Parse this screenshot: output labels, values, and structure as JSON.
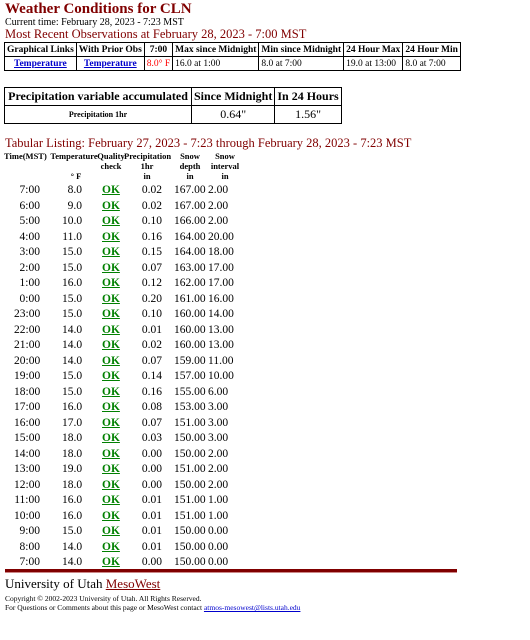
{
  "page": {
    "title": "Weather Conditions for CLN",
    "current_time": "Current time: February 28, 2023 - 7:23 MST",
    "recent_heading": "Most Recent Observations at February 28, 2023 - 7:00 MST"
  },
  "obs_table": {
    "headers": [
      "Graphical Links",
      "With Prior Obs",
      "7:00",
      "Max since Midnight",
      "Min since Midnight",
      "24 Hour Max",
      "24 Hour Min"
    ],
    "link1": "Temperature",
    "link2": "Temperature",
    "current": "8.0° F",
    "max_midnight": "16.0 at 1:00",
    "min_midnight": "8.0 at 7:00",
    "max_24": "19.0 at 13:00",
    "min_24": "8.0 at 7:00"
  },
  "precip_table": {
    "headers": [
      "Precipitation variable accumulated",
      "Since Midnight",
      "In 24 Hours"
    ],
    "label": "Precipitation 1hr",
    "since_midnight": "0.64\"",
    "in_24": "1.56\""
  },
  "tabular": {
    "heading": "Tabular Listing: February 27, 2023 - 7:23 through February 28, 2023 - 7:23 MST",
    "col_time": "Time(MST)",
    "col_temp": "Temperature",
    "col_temp_unit": "° F",
    "col_qc1": "Quality",
    "col_qc2": "check",
    "col_pr1": "Precipitation",
    "col_pr2": "1hr",
    "col_pr3": "in",
    "col_sd1": "Snow",
    "col_sd2": "depth",
    "col_sd3": "in",
    "col_si1": "Snow",
    "col_si2": "interval",
    "col_si3": "in",
    "rows": [
      {
        "time": "7:00",
        "temp": "8.0",
        "qc": "OK",
        "precip": "0.02",
        "depth": "167.00",
        "interval": "2.00"
      },
      {
        "time": "6:00",
        "temp": "9.0",
        "qc": "OK",
        "precip": "0.02",
        "depth": "167.00",
        "interval": "2.00"
      },
      {
        "time": "5:00",
        "temp": "10.0",
        "qc": "OK",
        "precip": "0.10",
        "depth": "166.00",
        "interval": "2.00"
      },
      {
        "time": "4:00",
        "temp": "11.0",
        "qc": "OK",
        "precip": "0.16",
        "depth": "164.00",
        "interval": "20.00"
      },
      {
        "time": "3:00",
        "temp": "15.0",
        "qc": "OK",
        "precip": "0.15",
        "depth": "164.00",
        "interval": "18.00"
      },
      {
        "time": "2:00",
        "temp": "15.0",
        "qc": "OK",
        "precip": "0.07",
        "depth": "163.00",
        "interval": "17.00"
      },
      {
        "time": "1:00",
        "temp": "16.0",
        "qc": "OK",
        "precip": "0.12",
        "depth": "162.00",
        "interval": "17.00"
      },
      {
        "time": "0:00",
        "temp": "15.0",
        "qc": "OK",
        "precip": "0.20",
        "depth": "161.00",
        "interval": "16.00"
      },
      {
        "time": "23:00",
        "temp": "15.0",
        "qc": "OK",
        "precip": "0.10",
        "depth": "160.00",
        "interval": "14.00"
      },
      {
        "time": "22:00",
        "temp": "14.0",
        "qc": "OK",
        "precip": "0.01",
        "depth": "160.00",
        "interval": "13.00"
      },
      {
        "time": "21:00",
        "temp": "14.0",
        "qc": "OK",
        "precip": "0.02",
        "depth": "160.00",
        "interval": "13.00"
      },
      {
        "time": "20:00",
        "temp": "14.0",
        "qc": "OK",
        "precip": "0.07",
        "depth": "159.00",
        "interval": "11.00"
      },
      {
        "time": "19:00",
        "temp": "15.0",
        "qc": "OK",
        "precip": "0.14",
        "depth": "157.00",
        "interval": "10.00"
      },
      {
        "time": "18:00",
        "temp": "15.0",
        "qc": "OK",
        "precip": "0.16",
        "depth": "155.00",
        "interval": "6.00"
      },
      {
        "time": "17:00",
        "temp": "16.0",
        "qc": "OK",
        "precip": "0.08",
        "depth": "153.00",
        "interval": "3.00"
      },
      {
        "time": "16:00",
        "temp": "17.0",
        "qc": "OK",
        "precip": "0.07",
        "depth": "151.00",
        "interval": "3.00"
      },
      {
        "time": "15:00",
        "temp": "18.0",
        "qc": "OK",
        "precip": "0.03",
        "depth": "150.00",
        "interval": "3.00"
      },
      {
        "time": "14:00",
        "temp": "18.0",
        "qc": "OK",
        "precip": "0.00",
        "depth": "150.00",
        "interval": "2.00"
      },
      {
        "time": "13:00",
        "temp": "19.0",
        "qc": "OK",
        "precip": "0.00",
        "depth": "151.00",
        "interval": "2.00"
      },
      {
        "time": "12:00",
        "temp": "18.0",
        "qc": "OK",
        "precip": "0.00",
        "depth": "150.00",
        "interval": "2.00"
      },
      {
        "time": "11:00",
        "temp": "16.0",
        "qc": "OK",
        "precip": "0.01",
        "depth": "151.00",
        "interval": "1.00"
      },
      {
        "time": "10:00",
        "temp": "16.0",
        "qc": "OK",
        "precip": "0.01",
        "depth": "151.00",
        "interval": "1.00"
      },
      {
        "time": "9:00",
        "temp": "15.0",
        "qc": "OK",
        "precip": "0.01",
        "depth": "150.00",
        "interval": "0.00"
      },
      {
        "time": "8:00",
        "temp": "14.0",
        "qc": "OK",
        "precip": "0.01",
        "depth": "150.00",
        "interval": "0.00"
      },
      {
        "time": "7:00",
        "temp": "14.0",
        "qc": "OK",
        "precip": "0.00",
        "depth": "150.00",
        "interval": "0.00"
      }
    ]
  },
  "footer": {
    "org": "University of Utah",
    "link": "MesoWest",
    "copyright": "Copyright © 2002-2023 University of Utah. All Rights Reserved.",
    "contact": "For Questions or Comments about this page or MesoWest contact",
    "email": "atmos-mesowest@lists.utah.edu"
  },
  "colors": {
    "heading": "#800000",
    "link": "#0000cc",
    "ok": "#008000",
    "alert": "#ff0000"
  }
}
